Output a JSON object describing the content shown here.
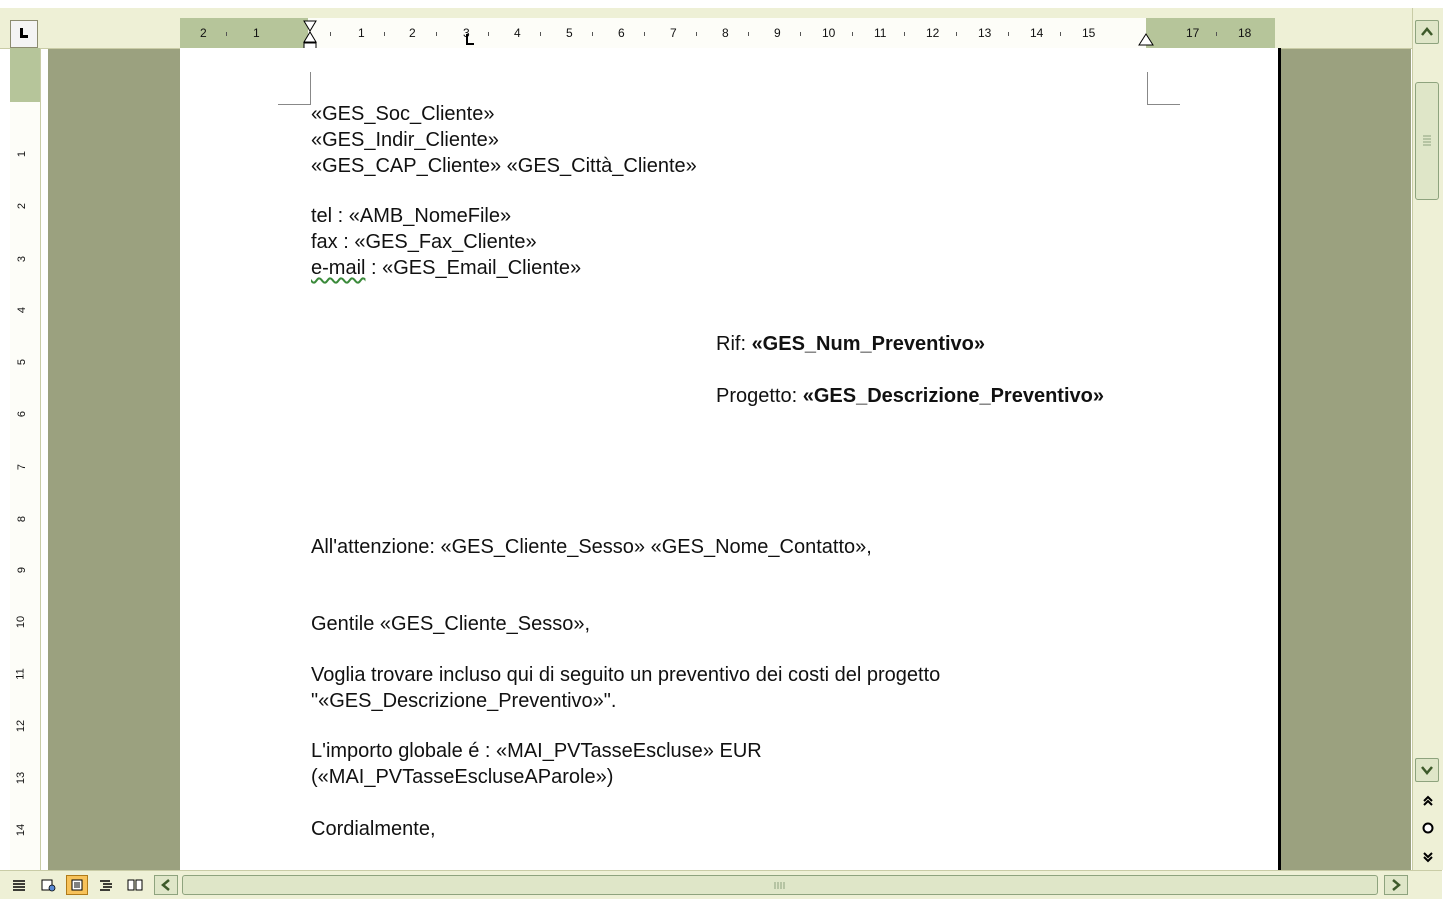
{
  "ruler": {
    "numbers": [
      "2",
      "1",
      "1",
      "2",
      "3",
      "4",
      "5",
      "6",
      "7",
      "8",
      "9",
      "10",
      "11",
      "12",
      "13",
      "14",
      "15",
      "17",
      "18"
    ],
    "vertical_numbers": [
      "1",
      "2",
      "3",
      "4",
      "5",
      "6",
      "7",
      "8",
      "9",
      "10",
      "11",
      "12",
      "13",
      "14"
    ]
  },
  "document": {
    "address": {
      "line1": "«GES_Soc_Cliente»",
      "line2": "«GES_Indir_Cliente»",
      "line3": "«GES_CAP_Cliente» «GES_Città_Cliente»"
    },
    "contacts": {
      "tel": "tel : «AMB_NomeFile»",
      "fax": "fax : «GES_Fax_Cliente»",
      "email_label": "e-mail",
      "email_value": " : «GES_Email_Cliente»"
    },
    "rif": {
      "label": "Rif: ",
      "value": "«GES_Num_Preventivo»"
    },
    "progetto": {
      "label": "Progetto: ",
      "value": "«GES_Descrizione_Preventivo»"
    },
    "attention": "All'attenzione: «GES_Cliente_Sesso» «GES_Nome_Contatto»,",
    "greeting": "Gentile «GES_Cliente_Sesso»,",
    "body1_line1": "Voglia trovare incluso qui di seguito un preventivo dei costi del progetto",
    "body1_line2": "\"«GES_Descrizione_Preventivo»\".",
    "body2_line1": "L'importo globale é : «MAI_PVTasseEscluse» EUR",
    "body2_line2": "(«MAI_PVTasseEscluseAParole»)",
    "closing": "Cordialmente,"
  },
  "icons": {
    "tab_selector": "left-tab-icon",
    "scroll_up": "scroll-up-icon",
    "scroll_down": "scroll-down-icon",
    "prev_page": "previous-page-icon",
    "select_browse": "select-browse-object-icon",
    "next_page": "next-page-icon",
    "scroll_left": "scroll-left-icon",
    "scroll_right": "scroll-right-icon",
    "normal_view": "normal-view-icon",
    "web_view": "web-layout-view-icon",
    "print_view": "print-layout-view-icon",
    "outline_view": "outline-view-icon",
    "reading_view": "reading-layout-view-icon"
  },
  "colors": {
    "workspace": "#9ba17f",
    "ruler_margin": "#b6c59a",
    "active_view": "#f7c25a"
  }
}
